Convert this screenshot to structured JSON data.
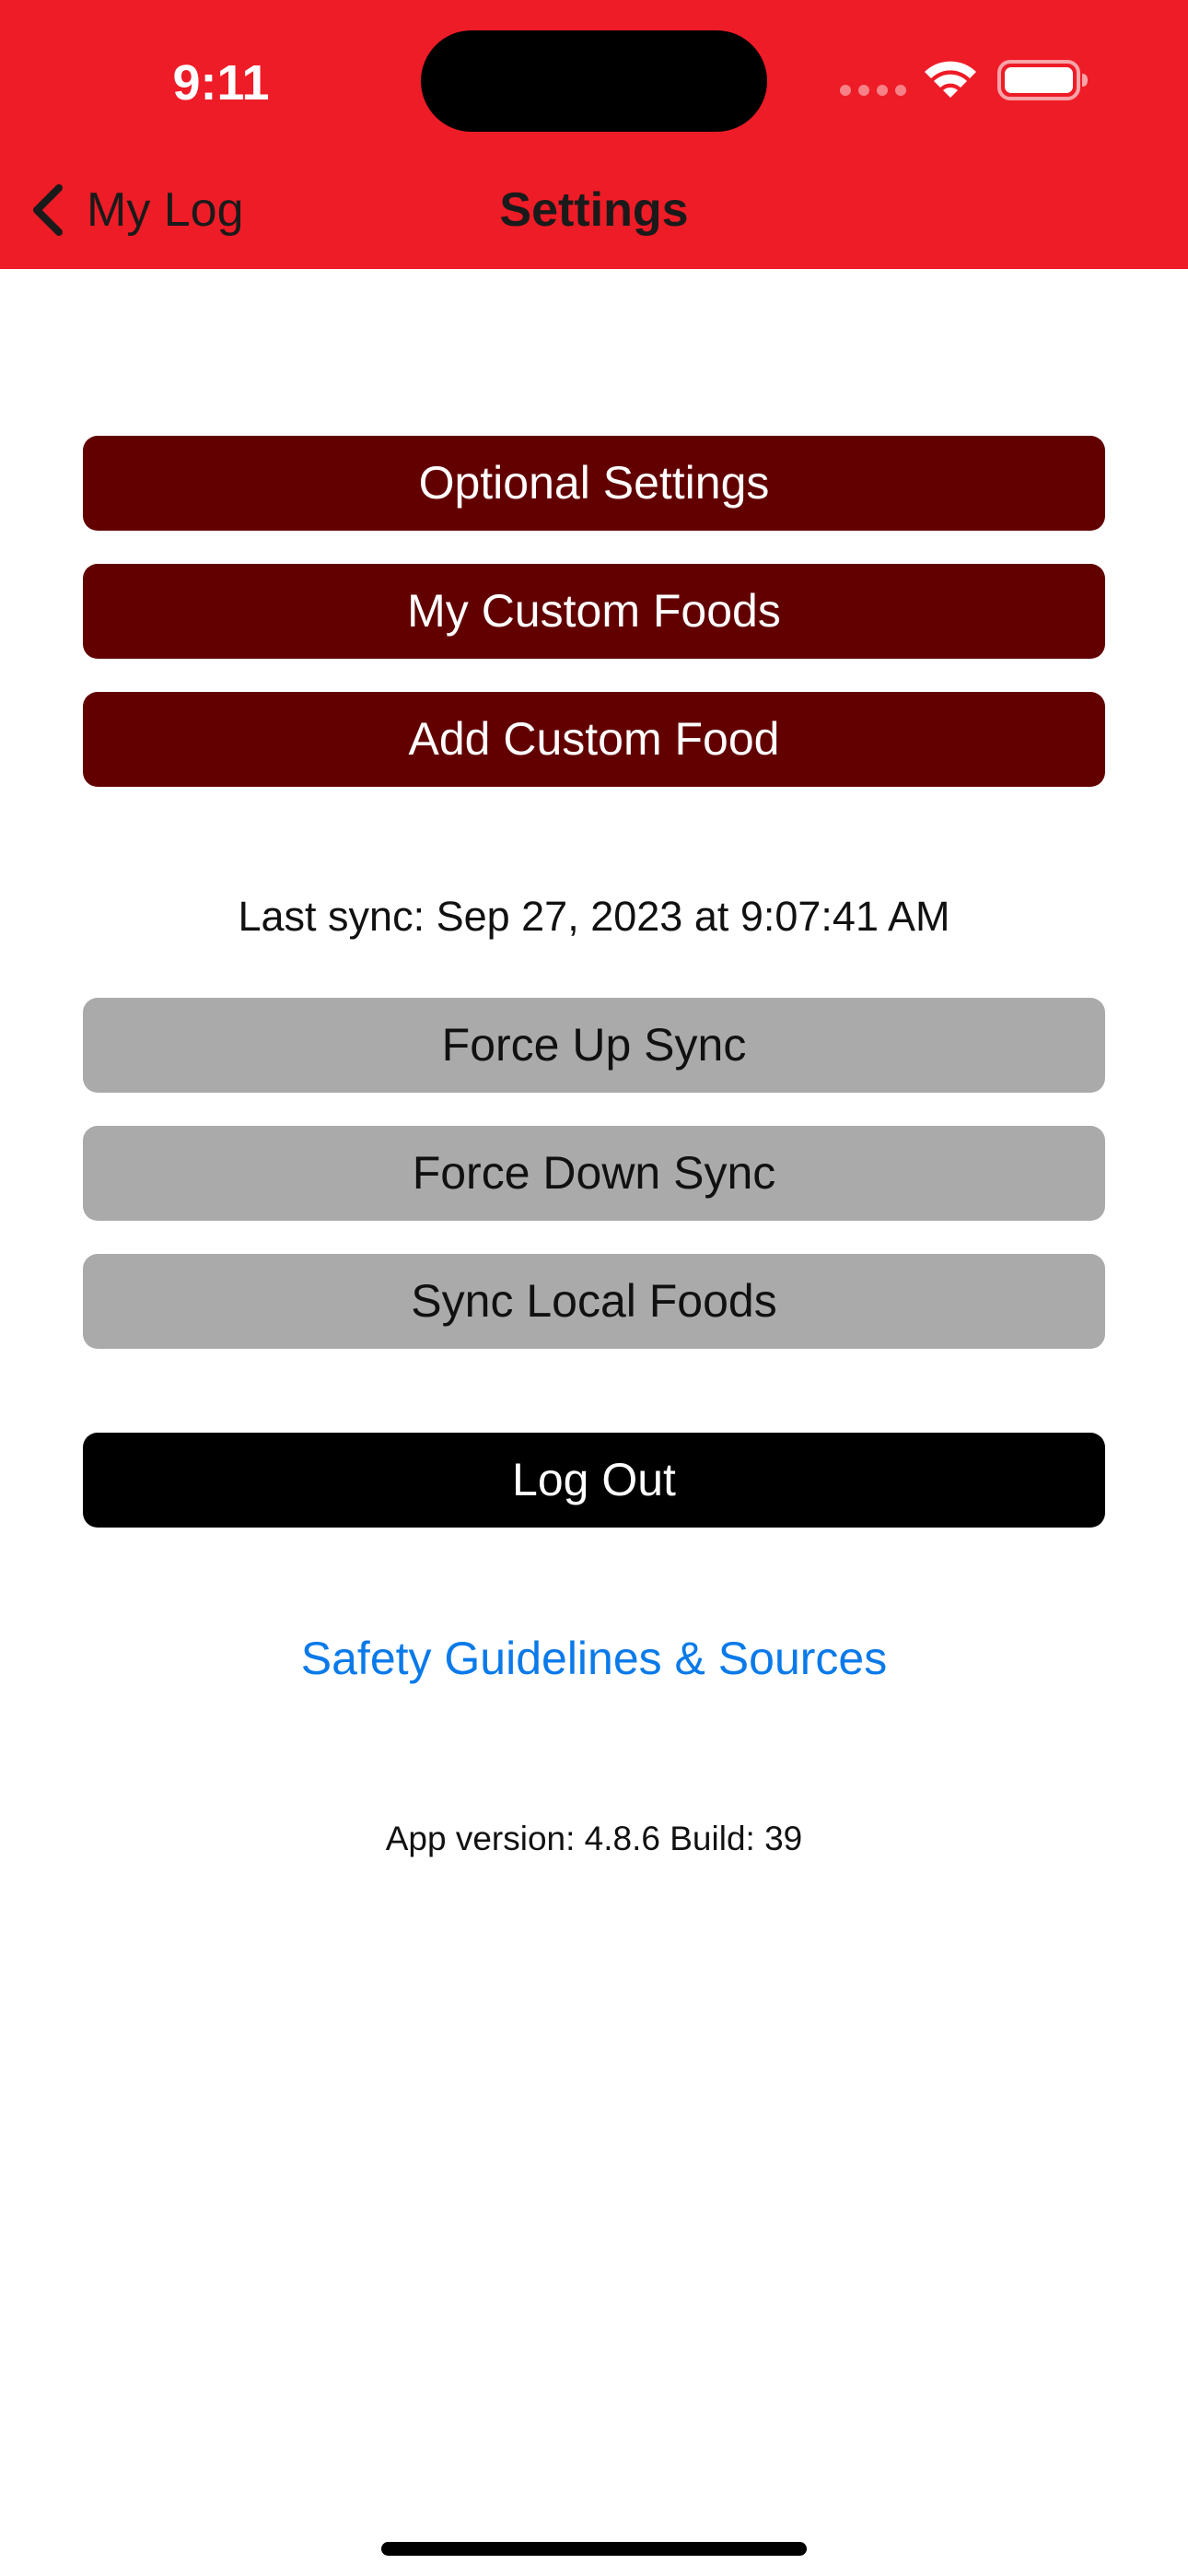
{
  "status_bar": {
    "time": "9:11"
  },
  "nav": {
    "back_label": "My Log",
    "title": "Settings"
  },
  "primary_buttons": {
    "optional_settings": "Optional Settings",
    "my_custom_foods": "My Custom Foods",
    "add_custom_food": "Add Custom Food"
  },
  "sync": {
    "last_sync": "Last sync: Sep 27, 2023 at 9:07:41 AM",
    "force_up": "Force Up Sync",
    "force_down": "Force Down Sync",
    "sync_local": "Sync Local Foods"
  },
  "logout_label": "Log Out",
  "safety_link": "Safety Guidelines & Sources",
  "app_version": "App version: 4.8.6 Build: 39",
  "colors": {
    "header_bg": "#EE1C27",
    "primary_button_bg": "#620000",
    "sync_button_bg": "#AAAAAA",
    "logout_button_bg": "#000000",
    "link": "#0A7AEA"
  },
  "icons": {
    "back": "chevron-left-icon",
    "wifi": "wifi-icon",
    "battery": "battery-icon",
    "cell_signal": "cell-signal-icon"
  }
}
